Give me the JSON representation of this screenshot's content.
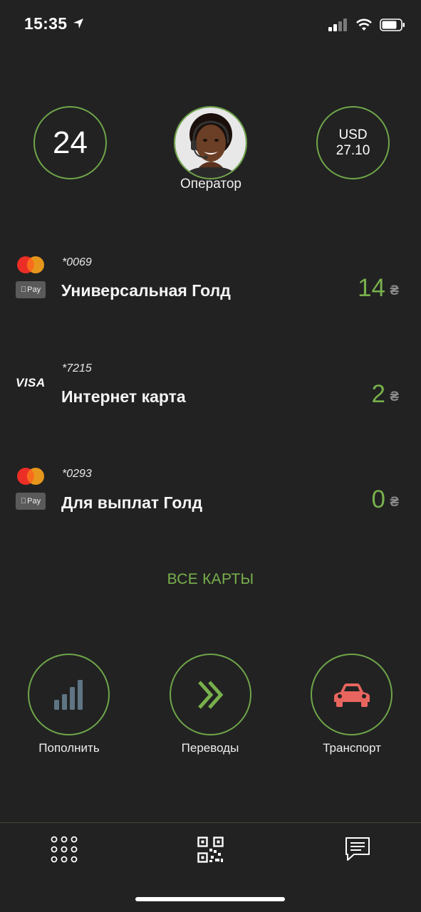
{
  "status_bar": {
    "time": "15:35",
    "icons": [
      "location-arrow-icon",
      "cellular-signal-icon",
      "wifi-icon",
      "battery-icon"
    ]
  },
  "header": {
    "days_value": "24",
    "operator_label": "Оператор",
    "rate_currency": "USD",
    "rate_value": "27.10"
  },
  "cards": [
    {
      "brand": "mastercard",
      "apple_pay": true,
      "apple_pay_label": "Pay",
      "number": "*0069",
      "name": "Универсальная Голд",
      "balance": "14",
      "currency": "₴"
    },
    {
      "brand": "visa",
      "brand_label": "VISA",
      "apple_pay": false,
      "number": "*7215",
      "name": "Интернет карта",
      "balance": "2",
      "currency": "₴"
    },
    {
      "brand": "mastercard",
      "apple_pay": true,
      "apple_pay_label": "Pay",
      "number": "*0293",
      "name": "Для выплат Голд",
      "balance": "0",
      "currency": "₴"
    }
  ],
  "all_cards_label": "ВСЕ КАРТЫ",
  "actions": [
    {
      "label": "Пополнить",
      "icon": "signal-bars-icon"
    },
    {
      "label": "Переводы",
      "icon": "double-chevron-right-icon"
    },
    {
      "label": "Транспорт",
      "icon": "car-icon"
    }
  ],
  "tabbar": {
    "icons": [
      "grid-menu-icon",
      "qr-code-icon",
      "chat-icon"
    ]
  },
  "colors": {
    "background": "#222222",
    "accent_green": "#78b04c",
    "circle_border": "#6fa54a",
    "car_red": "#e8655f",
    "bars_gray": "#5f7584"
  }
}
